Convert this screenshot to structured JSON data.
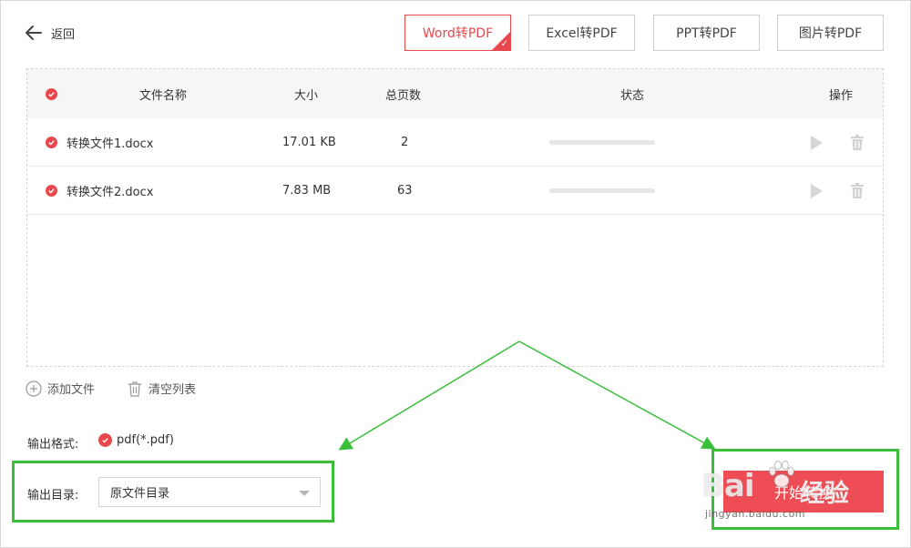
{
  "header": {
    "back_label": "返回",
    "tabs": [
      {
        "label": "Word转PDF",
        "active": true
      },
      {
        "label": "Excel转PDF",
        "active": false
      },
      {
        "label": "PPT转PDF",
        "active": false
      },
      {
        "label": "图片转PDF",
        "active": false
      }
    ]
  },
  "table": {
    "columns": {
      "name": "文件名称",
      "size": "大小",
      "pages": "总页数",
      "status": "状态",
      "actions": "操作"
    },
    "rows": [
      {
        "name": "转换文件1.docx",
        "size": "17.01 KB",
        "pages": "2",
        "progress": 0
      },
      {
        "name": "转换文件2.docx",
        "size": "7.83 MB",
        "pages": "63",
        "progress": 0
      }
    ]
  },
  "file_actions": {
    "add_label": "添加文件",
    "clear_label": "清空列表"
  },
  "output": {
    "format_label": "输出格式:",
    "format_value": "pdf(*.pdf)",
    "dir_label": "输出目录:",
    "dir_value": "原文件目录"
  },
  "start_button": {
    "label": "开始转换"
  },
  "watermark": {
    "logo": "Bai",
    "logo_suffix": "经验",
    "url": "jingyan.baidu.com"
  },
  "colors": {
    "accent": "#e8474d",
    "highlight": "#3bbf3b"
  }
}
